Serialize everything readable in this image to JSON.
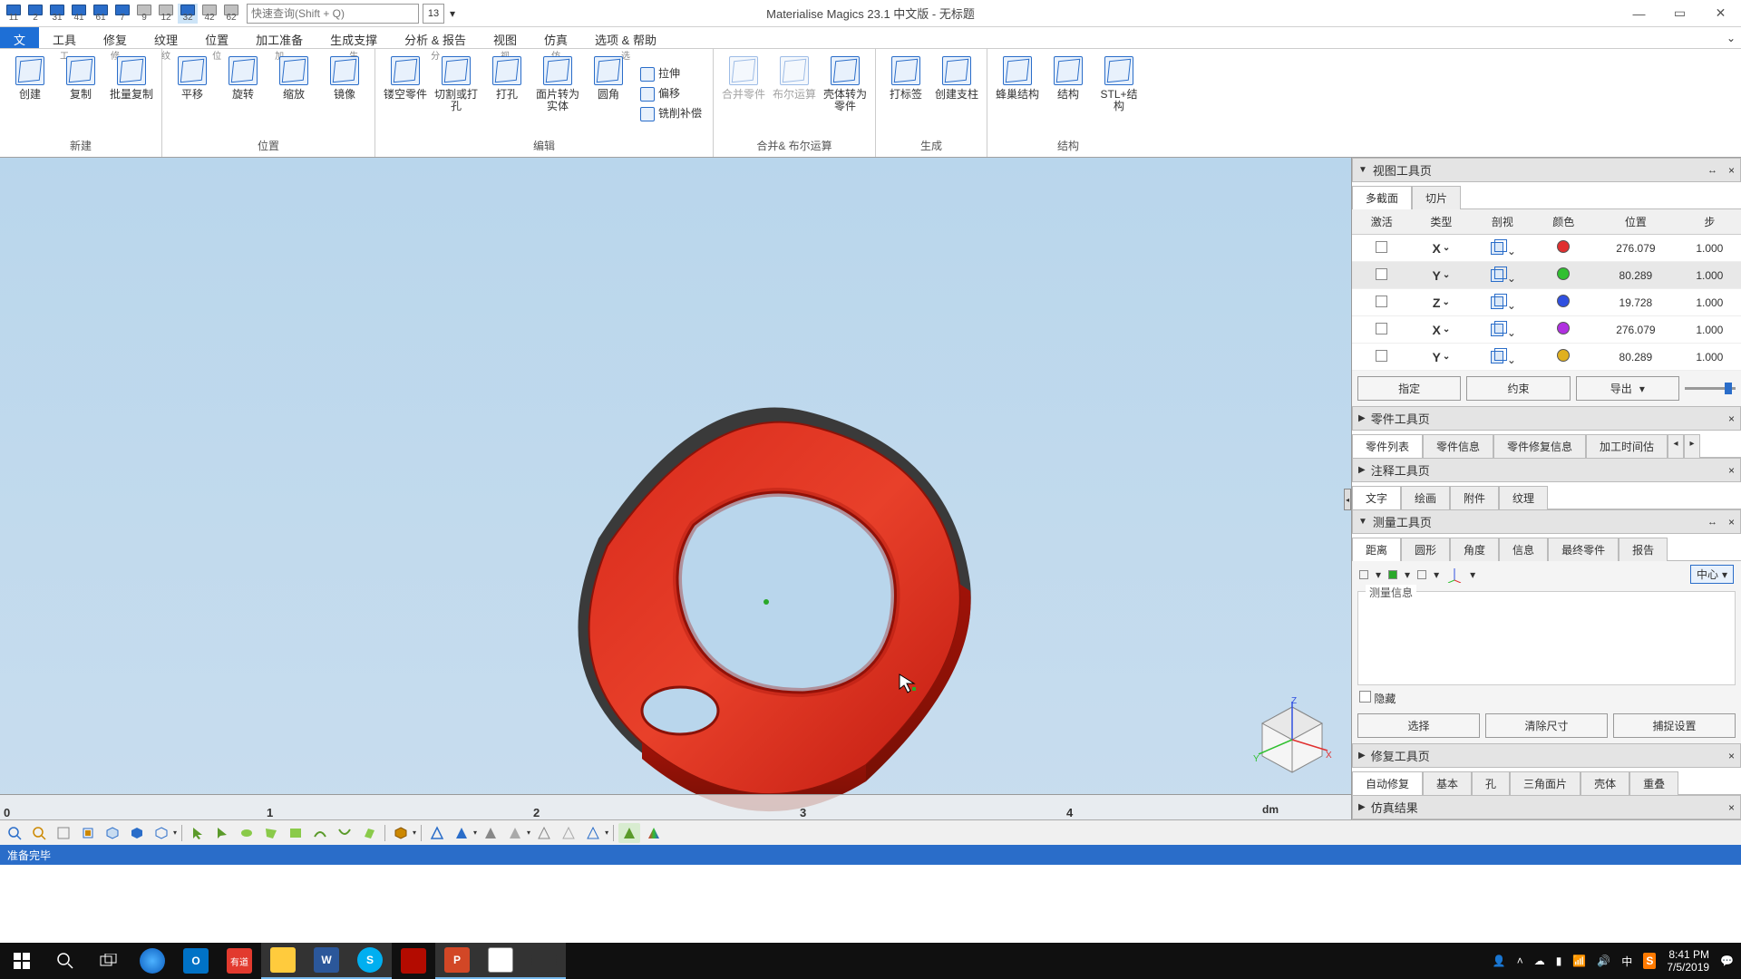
{
  "title": "Materialise Magics 23.1 中文版 - 无标题",
  "qat": {
    "search_placeholder": "快速查询(Shift + Q)",
    "search_num": "13",
    "items": [
      {
        "n": "11"
      },
      {
        "n": "2"
      },
      {
        "n": "31"
      },
      {
        "n": "41"
      },
      {
        "n": "61"
      },
      {
        "n": "7"
      },
      {
        "n": "9"
      },
      {
        "n": "12"
      },
      {
        "n": "32"
      },
      {
        "n": "42"
      },
      {
        "n": "62"
      }
    ]
  },
  "tabs": {
    "file": "文",
    "tools": "工具",
    "repair": "修复",
    "texture": "纹理",
    "position": "位置",
    "prep": "加工准备",
    "support": "生成支撑",
    "analyze": "分析 & 报告",
    "view": "视图",
    "sim": "仿真",
    "options": "选项 & 帮助",
    "sub": {
      "tools": "工",
      "repair": "修",
      "texture": "纹",
      "position": "位",
      "prep": "加",
      "support": "生",
      "analyze": "分",
      "view": "视",
      "sim": "仿",
      "options": "选"
    }
  },
  "ribbon": {
    "groups": {
      "create": {
        "name": "新建",
        "btns": [
          "创建",
          "复制",
          "批量复制"
        ]
      },
      "pos": {
        "name": "位置",
        "btns": [
          "平移",
          "旋转",
          "缩放",
          "镜像"
        ]
      },
      "edit": {
        "name": "编辑",
        "btns": [
          "镂空零件",
          "切割或打孔",
          "打孔",
          "面片转为实体",
          "圆角"
        ],
        "side": [
          "拉伸",
          "偏移",
          "铣削补偿"
        ]
      },
      "merge": {
        "name": "合并& 布尔运算",
        "btns": [
          "合并零件",
          "布尔运算",
          "壳体转为零件"
        ]
      },
      "gen": {
        "name": "生成",
        "btns": [
          "打标签",
          "创建支柱"
        ]
      },
      "struct": {
        "name": "结构",
        "btns": [
          "蜂巢结构",
          "结构",
          "STL+结构"
        ]
      }
    }
  },
  "ruler": {
    "ticks": [
      "0",
      "1",
      "2",
      "3",
      "4"
    ],
    "unit": "dm"
  },
  "side": {
    "view_tools": "视图工具页",
    "view_tabs": [
      "多截面",
      "切片"
    ],
    "section_cols": [
      "激活",
      "类型",
      "剖视",
      "颜色",
      "位置",
      "步"
    ],
    "section_rows": [
      {
        "axis": "X",
        "color": "#e03030",
        "pos": "276.079",
        "step": "1.000"
      },
      {
        "axis": "Y",
        "color": "#30c030",
        "pos": "80.289",
        "step": "1.000"
      },
      {
        "axis": "Z",
        "color": "#3050e0",
        "pos": "19.728",
        "step": "1.000"
      },
      {
        "axis": "X",
        "color": "#b030e0",
        "pos": "276.079",
        "step": "1.000"
      },
      {
        "axis": "Y",
        "color": "#e0b020",
        "pos": "80.289",
        "step": "1.000"
      }
    ],
    "section_btns": [
      "指定",
      "约束",
      "导出"
    ],
    "part_tools": "零件工具页",
    "part_tabs": [
      "零件列表",
      "零件信息",
      "零件修复信息",
      "加工时间估"
    ],
    "anno_tools": "注释工具页",
    "anno_tabs": [
      "文字",
      "绘画",
      "附件",
      "纹理"
    ],
    "meas_tools": "测量工具页",
    "meas_tabs": [
      "距离",
      "圆形",
      "角度",
      "信息",
      "最终零件",
      "报告"
    ],
    "meas_info": "测量信息",
    "meas_center": "中心",
    "hide": "隐藏",
    "meas_btns": [
      "选择",
      "清除尺寸",
      "捕捉设置"
    ],
    "repair_tools": "修复工具页",
    "repair_tabs": [
      "自动修复",
      "基本",
      "孔",
      "三角面片",
      "壳体",
      "重叠"
    ],
    "sim_result": "仿真结果"
  },
  "status": "准备完毕",
  "taskbar": {
    "time": "8:41 PM",
    "date": "7/5/2019",
    "ime": "中"
  }
}
